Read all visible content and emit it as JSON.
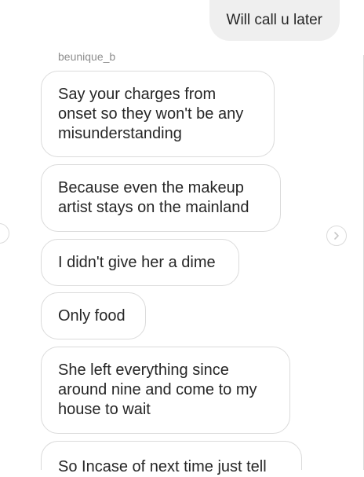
{
  "thread": {
    "sent_message": "Will call u later",
    "sender_name": "beunique_b",
    "messages": [
      "Say your charges from\nonset so they won't be any\nmisunderstanding",
      "Because even the makeup\nartist stays on the mainland",
      "I didn't give her a dime",
      "Only food",
      "She left everything since\naround nine and come to my\nhouse to wait",
      "So Incase of next time just tell"
    ]
  }
}
